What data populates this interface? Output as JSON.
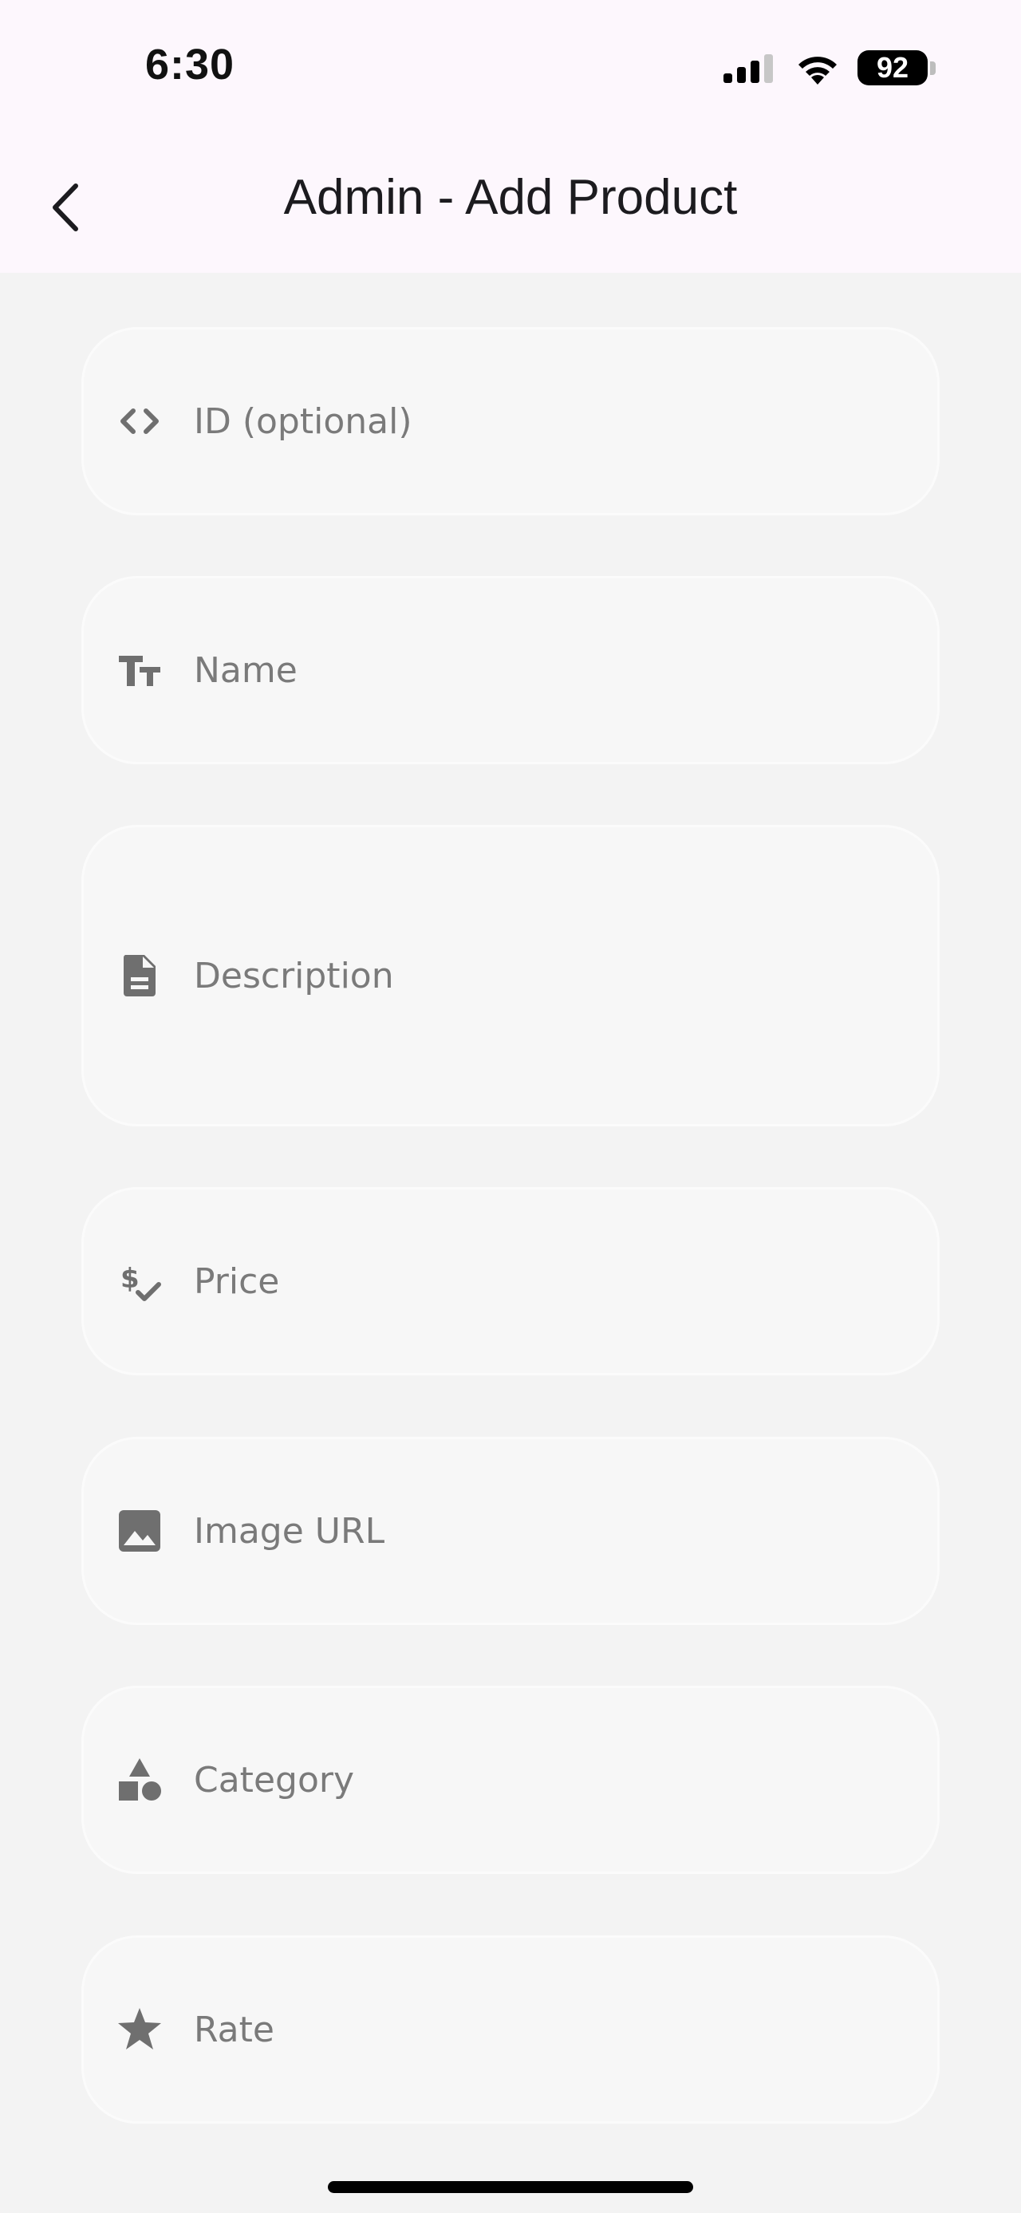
{
  "status_bar": {
    "time": "6:30",
    "battery": "92"
  },
  "header": {
    "title": "Admin - Add Product"
  },
  "form": {
    "fields": [
      {
        "placeholder": "ID (optional)",
        "icon": "code-icon"
      },
      {
        "placeholder": "Name",
        "icon": "text-fields-icon"
      },
      {
        "placeholder": "Description",
        "icon": "document-icon"
      },
      {
        "placeholder": "Price",
        "icon": "price-check-icon"
      },
      {
        "placeholder": "Image URL",
        "icon": "image-icon"
      },
      {
        "placeholder": "Category",
        "icon": "category-icon"
      },
      {
        "placeholder": "Rate",
        "icon": "star-icon"
      }
    ]
  },
  "colors": {
    "app_bar": "#fdf7fd",
    "background": "#f3f3f3",
    "field": "#f7f7f7",
    "icon": "#6f6f6f"
  }
}
